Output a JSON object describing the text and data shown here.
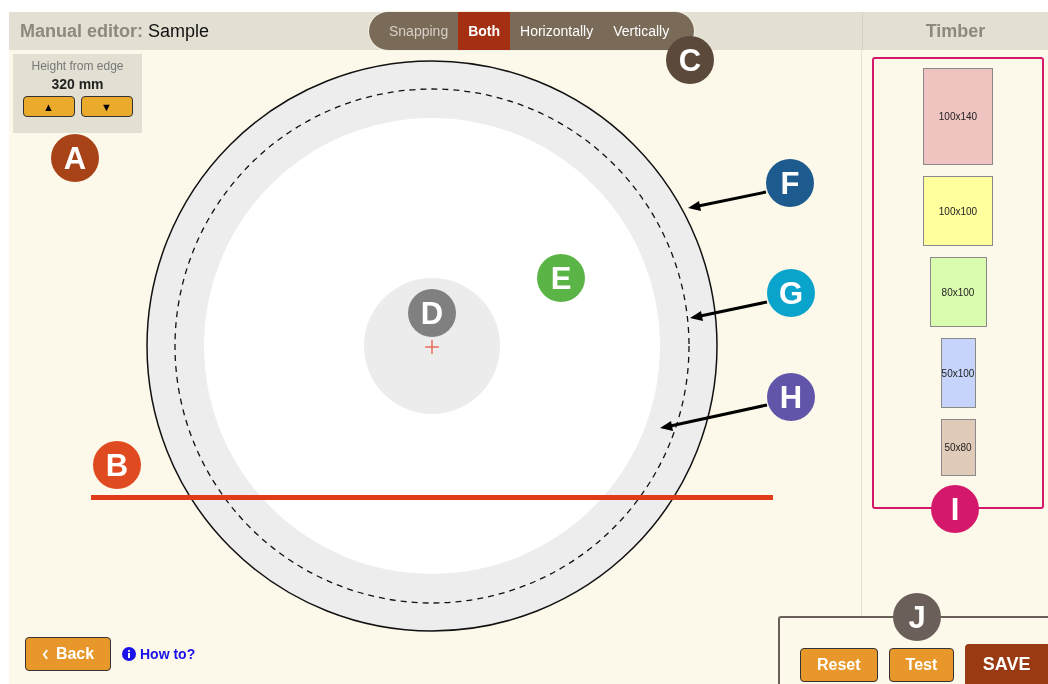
{
  "title": {
    "label": "Manual editor:",
    "name": "Sample"
  },
  "snapping": {
    "label": "Snapping",
    "options": [
      {
        "label": "Both",
        "selected": true
      },
      {
        "label": "Horizontally",
        "selected": false
      },
      {
        "label": "Vertically",
        "selected": false
      }
    ]
  },
  "height_control": {
    "label": "Height from edge",
    "value": "320 mm",
    "buttons": [
      "▲",
      "▼"
    ]
  },
  "timber": {
    "title": "Timber",
    "items": [
      {
        "label": "100x140",
        "color": "#efc3c0"
      },
      {
        "label": "100x100",
        "color": "#ffff9e"
      },
      {
        "label": "80x100",
        "color": "#d9fcae"
      },
      {
        "label": "50x100",
        "color": "#c6d4fb"
      },
      {
        "label": "50x80",
        "color": "#dfcbb8"
      }
    ]
  },
  "footer": {
    "back": "Back",
    "help": "How to?",
    "actions": [
      "Reset",
      "Test"
    ],
    "save": "SAVE"
  },
  "markers": [
    {
      "label": "A",
      "color": "#a84318"
    },
    {
      "label": "B",
      "color": "#e04a20"
    },
    {
      "label": "C",
      "color": "#5b4a3b"
    },
    {
      "label": "D",
      "color": "#808080"
    },
    {
      "label": "E",
      "color": "#5bb546"
    },
    {
      "label": "F",
      "color": "#1d5b8e"
    },
    {
      "label": "G",
      "color": "#0aa3cc"
    },
    {
      "label": "H",
      "color": "#6055a8"
    },
    {
      "label": "I",
      "color": "#d4186c"
    },
    {
      "label": "J",
      "color": "#6b5f5a"
    }
  ]
}
